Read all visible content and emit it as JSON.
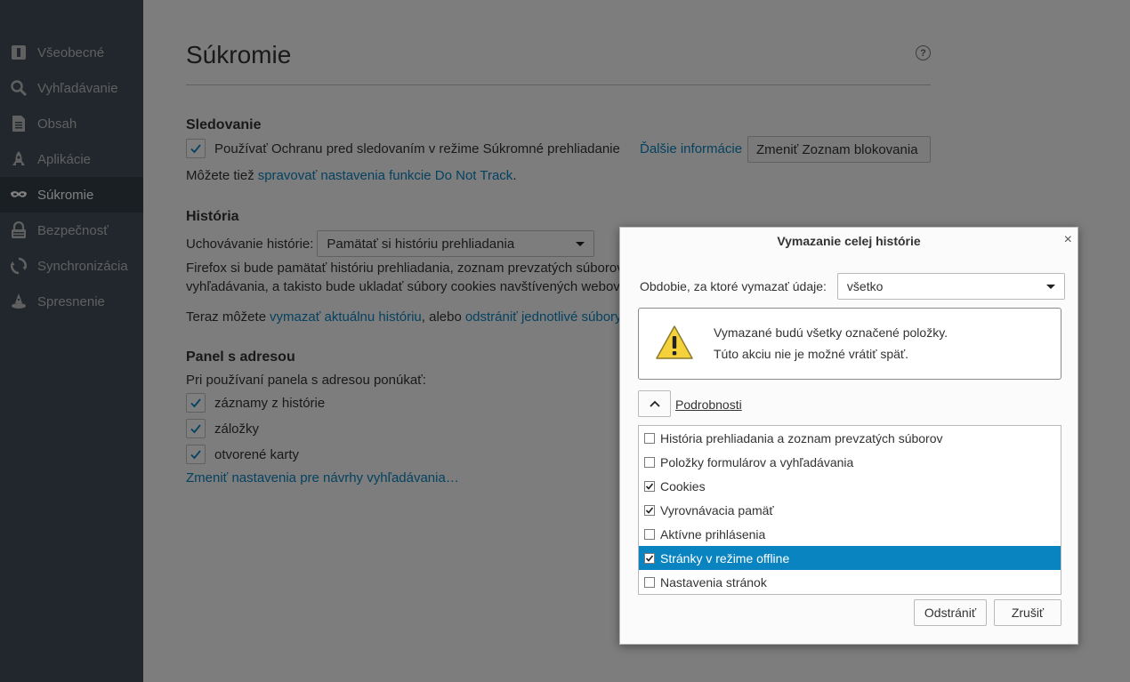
{
  "sidebar": {
    "items": [
      {
        "label": "Všeobecné",
        "icon": "general-icon"
      },
      {
        "label": "Vyhľadávanie",
        "icon": "search-icon"
      },
      {
        "label": "Obsah",
        "icon": "content-icon"
      },
      {
        "label": "Aplikácie",
        "icon": "applications-icon"
      },
      {
        "label": "Súkromie",
        "icon": "privacy-mask-icon"
      },
      {
        "label": "Bezpečnosť",
        "icon": "security-lock-icon"
      },
      {
        "label": "Synchronizácia",
        "icon": "sync-icon"
      },
      {
        "label": "Spresnenie",
        "icon": "advanced-wizard-icon"
      }
    ],
    "selected_index": 4
  },
  "main": {
    "title": "Súkromie",
    "help_symbol": "?",
    "tracking": {
      "heading": "Sledovanie",
      "checkbox_label": "Používať Ochranu pred sledovaním v režime Súkromné prehliadanie",
      "more_info_link": "Ďalšie informácie",
      "change_blocklist_button": "Zmeniť Zoznam blokovania",
      "dnt_prefix": "Môžete tiež ",
      "dnt_link": "spravovať nastavenia funkcie Do Not Track",
      "dnt_suffix": "."
    },
    "history": {
      "heading": "História",
      "retention_label": "Uchovávanie histórie:",
      "retention_value": "Pamätať si históriu prehliadania",
      "desc_line1": "Firefox si bude pamätať históriu prehliadania, zoznam prevzatých súborov",
      "desc_line2": "vyhľadávania, a takisto bude ukladať súbory cookies navštívených webový",
      "clear_prefix": "Teraz môžete ",
      "clear_link": "vymazať aktuálnu históriu",
      "clear_middle": ", alebo ",
      "remove_link": "odstrániť jednotlivé súbory"
    },
    "urlbar": {
      "heading": "Panel s adresou",
      "intro": "Pri používaní panela s adresou ponúkať:",
      "options": [
        {
          "label": "záznamy z histórie",
          "checked": true
        },
        {
          "label": "záložky",
          "checked": true
        },
        {
          "label": "otvorené karty",
          "checked": true
        }
      ],
      "suggest_link": "Zmeniť nastavenia pre návrhy vyhľadávania…"
    }
  },
  "dialog": {
    "title": "Vymazanie celej histórie",
    "close_symbol": "×",
    "period_label": "Obdobie, za ktoré vymazať údaje:",
    "period_value": "všetko",
    "warning_line1": "Vymazané budú všetky označené položky.",
    "warning_line2": "Túto akciu nie je možné vrátiť späť.",
    "details_label": "Podrobnosti",
    "items": [
      {
        "label": "História prehliadania a zoznam prevzatých súborov",
        "checked": false,
        "selected": false
      },
      {
        "label": "Položky formulárov a vyhľadávania",
        "checked": false,
        "selected": false
      },
      {
        "label": "Cookies",
        "checked": true,
        "selected": false
      },
      {
        "label": "Vyrovnávacia pamäť",
        "checked": true,
        "selected": false
      },
      {
        "label": "Aktívne prihlásenia",
        "checked": false,
        "selected": false
      },
      {
        "label": "Stránky v režime offline",
        "checked": true,
        "selected": true
      },
      {
        "label": "Nastavenia stránok",
        "checked": false,
        "selected": false
      }
    ],
    "remove_button": "Odstrániť",
    "cancel_button": "Zrušiť"
  },
  "colors": {
    "sidebar_bg": "#424f5a",
    "sidebar_selected_bg": "#343f48",
    "link": "#0a84c1",
    "selection": "#0a84c1"
  }
}
